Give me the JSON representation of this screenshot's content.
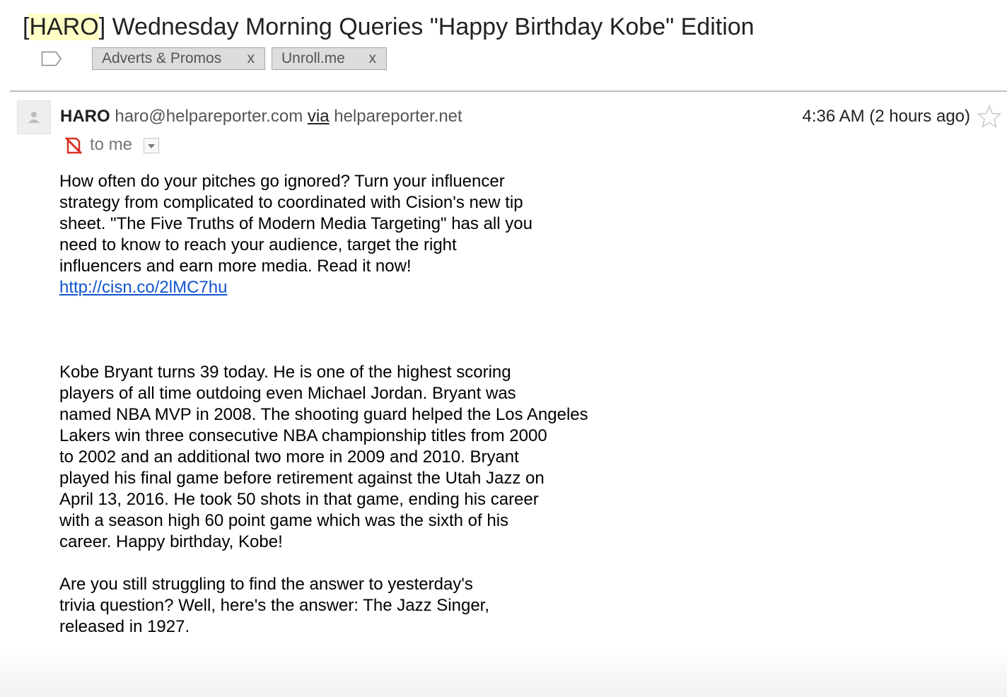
{
  "email": {
    "subject_prefix_open": "[",
    "subject_highlight": "HARO",
    "subject_rest": "] Wednesday Morning Queries \"Happy Birthday Kobe\" Edition",
    "labels": [
      {
        "name": "Adverts & Promos",
        "remove": "x"
      },
      {
        "name": "Unroll.me",
        "remove": "x"
      }
    ],
    "sender": {
      "name": "HARO",
      "address": "haro@helpareporter.com",
      "via_label": "via",
      "via_domain": "helpareporter.net"
    },
    "recipient": "to me",
    "time": "4:36 AM (2 hours ago)",
    "body": {
      "para1": "How often do your pitches go ignored? Turn your influencer\nstrategy from complicated to coordinated with Cision's new tip\nsheet. \"The Five Truths of Modern Media Targeting\" has all you\nneed to know to reach your audience, target the right\ninfluencers and earn more media. Read it now!",
      "link": "http://cisn.co/2lMC7hu",
      "para2": "Kobe Bryant turns 39 today. He is one of the highest scoring\nplayers of all time outdoing even Michael Jordan. Bryant was\nnamed NBA MVP in 2008. The shooting guard helped the Los Angeles\nLakers win three consecutive NBA championship titles from 2000\nto 2002 and an additional two more in 2009 and 2010. Bryant\nplayed his final game before retirement against the Utah Jazz on\nApril 13, 2016. He took 50 shots in that game, ending his career\nwith a season high 60 point game which was the sixth of his\ncareer. Happy birthday, Kobe!",
      "para3": "Are you still struggling to find the answer to yesterday's\ntrivia question? Well, here's the answer: The Jazz Singer,\nreleased in 1927."
    }
  },
  "icons": {
    "label": "label-icon",
    "avatar": "person-icon",
    "recipient_status": "no-entry-icon",
    "dropdown": "chevron-down-icon",
    "star": "star-icon"
  },
  "colors": {
    "highlight": "#ffffc6",
    "link": "#1155cc",
    "chip_bg": "#dddddd",
    "no_entry_red": "#d93025"
  }
}
